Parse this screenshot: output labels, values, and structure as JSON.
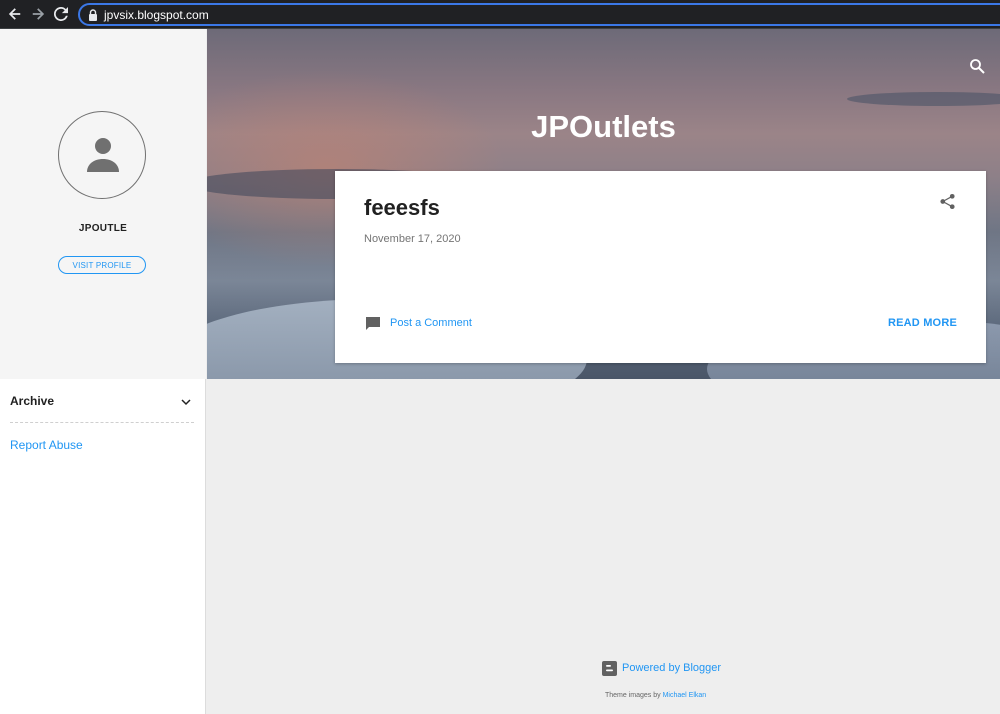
{
  "browser": {
    "url": "jpvsix.blogspot.com"
  },
  "sidebar": {
    "profile_name": "JPOUTLE",
    "visit_profile_label": "VISIT PROFILE",
    "archive_label": "Archive",
    "report_abuse_label": "Report Abuse"
  },
  "header": {
    "site_title": "JPOutlets"
  },
  "post": {
    "title": "feeesfs",
    "date": "November 17, 2020",
    "comment_label": "Post a Comment",
    "read_more_label": "READ MORE"
  },
  "footer": {
    "powered_by": "Powered by Blogger",
    "theme_prefix": "Theme images by ",
    "theme_author": "Michael Elkan"
  },
  "colors": {
    "accent": "#2196f3",
    "card_bg": "#ffffff",
    "page_bg": "#eeeeee",
    "sidebar_profile_bg": "#f5f5f5"
  }
}
